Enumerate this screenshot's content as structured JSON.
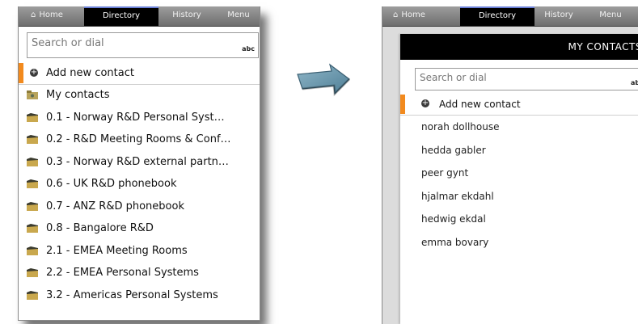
{
  "left_panel": {
    "tabs": [
      {
        "label": "Home",
        "icon": "home-icon"
      },
      {
        "label": "Directory"
      },
      {
        "label": "History"
      },
      {
        "label": "Menu"
      }
    ],
    "search": {
      "placeholder": "Search or dial",
      "mode": "abc"
    },
    "add_contact": "Add new contact",
    "folders": [
      "My contacts",
      "0.1 - Norway R&D Personal Syst…",
      "0.2 - R&D Meeting Rooms & Conf…",
      "0.3 - Norway R&D external partn…",
      "0.6 - UK R&D phonebook",
      "0.7 - ANZ R&D phonebook",
      "0.8 - Bangalore R&D",
      "2.1 - EMEA Meeting Rooms",
      "2.2 - EMEA Personal Systems",
      "3.2 - Americas Personal Systems"
    ]
  },
  "right_panel": {
    "tabs": [
      {
        "label": "Home",
        "icon": "home-icon"
      },
      {
        "label": "Directory"
      },
      {
        "label": "History"
      },
      {
        "label": "Menu"
      }
    ],
    "header": "MY CONTACTS",
    "search": {
      "placeholder": "Search or dial",
      "mode": "abc"
    },
    "add_contact": "Add new contact",
    "contacts": [
      "norah dollhouse",
      "hedda gabler",
      "peer gynt",
      "hjalmar ekdahl",
      "hedwig ekdal",
      "emma bovary"
    ]
  },
  "colors": {
    "accent": "#f28a1e",
    "active_tab": "#000000",
    "tab_bar": "#7f7f7f",
    "arrow": "#4f7f96"
  }
}
